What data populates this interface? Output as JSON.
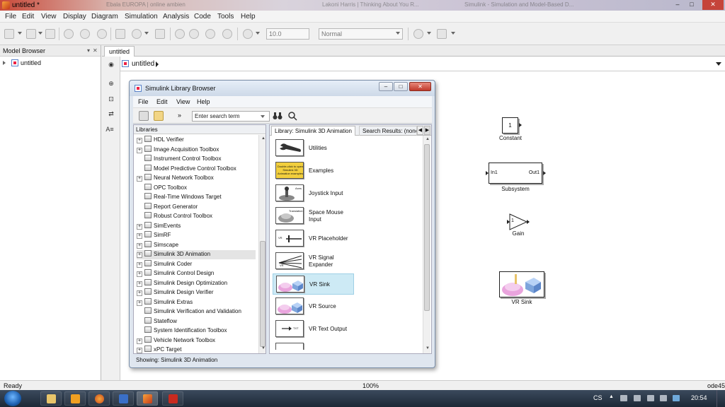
{
  "window": {
    "title": "untitled *",
    "background_tabs": [
      "Ebala EUROPA | online ambien",
      "Lakoni Harris | Thinking About You R...",
      "Simulink - Simulation and Model-Based D..."
    ],
    "minimize": "–",
    "maximize": "□",
    "close": "✕"
  },
  "menubar": [
    "File",
    "Edit",
    "View",
    "Display",
    "Diagram",
    "Simulation",
    "Analysis",
    "Code",
    "Tools",
    "Help"
  ],
  "toolbar": {
    "stop_time": "10.0",
    "sim_mode": "Normal"
  },
  "model_browser": {
    "title": "Model Browser",
    "menu_icon": "▾",
    "close_icon": "✕",
    "root_item": "untitled",
    "collapse_label": "«"
  },
  "editor": {
    "tab_label": "untitled",
    "breadcrumb": "untitled",
    "palette_icons": [
      "◉",
      "⊕",
      "⊡",
      "⇄",
      "A≡"
    ]
  },
  "canvas_blocks": {
    "constant": {
      "value": "1",
      "name": "Constant"
    },
    "subsystem": {
      "in_port": "In1",
      "out_port": "Out1",
      "name": "Subsystem"
    },
    "gain": {
      "value": "1",
      "name": "Gain"
    },
    "vr_sink": {
      "name": "VR Sink"
    }
  },
  "library_browser": {
    "title": "Simulink Library Browser",
    "minimize": "–",
    "maximize": "□",
    "close": "✕",
    "menu": [
      "File",
      "Edit",
      "View",
      "Help"
    ],
    "search_placeholder": "Enter search term",
    "more_icon": "»",
    "libraries_header": "Libraries",
    "libraries": [
      {
        "label": "HDL Verifier",
        "expandable": true
      },
      {
        "label": "Image Acquisition Toolbox",
        "expandable": true
      },
      {
        "label": "Instrument Control Toolbox",
        "expandable": false
      },
      {
        "label": "Model Predictive Control Toolbox",
        "expandable": false
      },
      {
        "label": "Neural Network Toolbox",
        "expandable": true
      },
      {
        "label": "OPC Toolbox",
        "expandable": false
      },
      {
        "label": "Real-Time Windows Target",
        "expandable": false
      },
      {
        "label": "Report Generator",
        "expandable": false
      },
      {
        "label": "Robust Control Toolbox",
        "expandable": false
      },
      {
        "label": "SimEvents",
        "expandable": true
      },
      {
        "label": "SimRF",
        "expandable": true
      },
      {
        "label": "Simscape",
        "expandable": true
      },
      {
        "label": "Simulink 3D Animation",
        "expandable": true,
        "selected": true
      },
      {
        "label": "Simulink Coder",
        "expandable": true
      },
      {
        "label": "Simulink Control Design",
        "expandable": true
      },
      {
        "label": "Simulink Design Optimization",
        "expandable": true
      },
      {
        "label": "Simulink Design Verifier",
        "expandable": true
      },
      {
        "label": "Simulink Extras",
        "expandable": true
      },
      {
        "label": "Simulink Verification and Validation",
        "expandable": false
      },
      {
        "label": "Stateflow",
        "expandable": false
      },
      {
        "label": "System Identification Toolbox",
        "expandable": false
      },
      {
        "label": "Vehicle Network Toolbox",
        "expandable": true
      },
      {
        "label": "xPC Target",
        "expandable": true
      }
    ],
    "tab_library": "Library: Simulink 3D Animation",
    "tab_search": "Search Results: (none)",
    "blocks": [
      {
        "label": "Utilities",
        "icon": "wrench-icon"
      },
      {
        "label": "Examples",
        "icon": "examples-icon",
        "thumb_text": "Double-click to open Simulink 3D Animation examples"
      },
      {
        "label": "Joystick Input",
        "icon": "joystick-icon",
        "thumb_text": "Axes"
      },
      {
        "label": "Space Mouse Input",
        "icon": "spacemouse-icon",
        "thumb_text": "Translation"
      },
      {
        "label": "VR Placeholder",
        "icon": "placeholder-icon",
        "thumb_text": "VR"
      },
      {
        "label": "VR Signal Expander",
        "icon": "expander-icon",
        "thumb_text": "VR"
      },
      {
        "label": "VR Sink",
        "icon": "vr-sink-icon",
        "selected": true
      },
      {
        "label": "VR Source",
        "icon": "vr-source-icon"
      },
      {
        "label": "VR Text Output",
        "icon": "text-output-icon",
        "thumb_text": "TXT"
      }
    ],
    "status": "Showing: Simulink 3D Animation"
  },
  "statusbar": {
    "left": "Ready",
    "zoom": "100%",
    "solver": "ode45"
  },
  "taskbar": {
    "lang": "CS",
    "clock": "20:54"
  },
  "colors": {
    "selection": "#cdeaf5",
    "close_red": "#c5443a"
  }
}
